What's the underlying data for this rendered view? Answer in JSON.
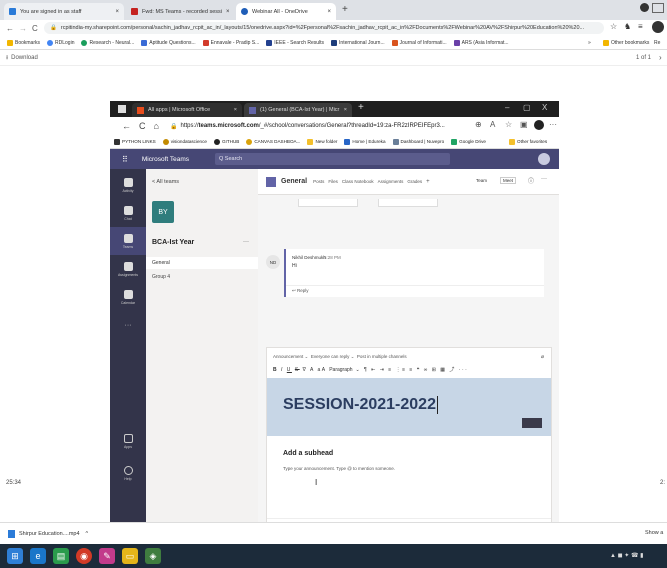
{
  "browser": {
    "tabs": [
      {
        "label": "You are signed in as staff",
        "fav_color": "#2b7bd8"
      },
      {
        "label": "Fwd: MS Teams - recorded sessi",
        "fav_color": "#c5221f"
      },
      {
        "label": "Webinar All - OneDrive",
        "fav_color": "#1f5eb8"
      }
    ],
    "address": "rcpitindia-my.sharepoint.com/personal/sachin_jadhav_rcpit_ac_in/_layouts/15/onedrive.aspx?id=%2Fpersonal%2Fsachin_jadhav_rcpit_ac_in%2FDocuments%2FWebinar%20AV%2FShirpur%20Education%20%20...",
    "bookmarks": [
      "Bookmarks",
      "RDLogin",
      "Research - Neural...",
      "Aptitude Questions...",
      "Ennavale - Pradip S...",
      "IEEE - Search Results",
      "International Journ...",
      "Journal of Informati...",
      "ARS (Asia Informat..."
    ],
    "other_bookmarks": "Other bookmarks",
    "bookmarks_overflow": "»",
    "read_label": "Re"
  },
  "viewer": {
    "download_label": "Download",
    "page_counter": "1 of 1",
    "next_label": "›",
    "time_left": "25:34",
    "time_right": "2:"
  },
  "inner": {
    "tabs": [
      {
        "label": "All apps | Microsoft Office"
      },
      {
        "label": "(1) General (BCA-Ist Year) | Micr"
      }
    ],
    "address_prefix": "https://",
    "address_host": "teams.microsoft.com",
    "address_path": "/_#/school/conversations/General?threadId=19:za-FR2zIRPEIFEpr3...",
    "bookmarks": [
      "PYTHON LINKS",
      "visiondatascience",
      "GITHUB",
      "CANVAS DASHBOA...",
      "New folder",
      "Home | Edureka",
      "Dashboard | Nuvepro",
      "Google Drive"
    ],
    "other_bookmarks": "Other favorites",
    "window_controls": [
      "–",
      "▢",
      "X"
    ]
  },
  "teams": {
    "app_name": "Microsoft Teams",
    "search_placeholder": "Q Search",
    "rail": [
      "Activity",
      "Chat",
      "Teams",
      "Assignments",
      "Calendar",
      "···"
    ],
    "rail_bottom": [
      "Apps",
      "Help"
    ],
    "back_label": "< All teams",
    "avatar": "BY",
    "team_name": "BCA-Ist Year",
    "team_more": "···",
    "channels": [
      "General",
      "Group 4"
    ],
    "channel_name": "General",
    "channel_tabs": [
      "Posts",
      "Files",
      "Class Notebook",
      "Assignments",
      "Grades",
      "+"
    ],
    "header_right": [
      "Team",
      "Meet",
      "ⓘ",
      "···"
    ],
    "message": {
      "initials": "ND",
      "author": "Nikhil Deshmukh",
      "time": "5:28 PM",
      "text": "Hi",
      "reply": "↩ Reply"
    },
    "compose": {
      "announcement_chip": "Announcement",
      "reply_chip": "Everyone can reply",
      "post_in_chip": "Post in multiple channels",
      "paragraph_label": "Paragraph",
      "format_tools": [
        "B",
        "I",
        "U",
        "S",
        "∇",
        "A",
        "aA"
      ],
      "headline": "SESSION-2021-2022",
      "subhead": "Add a subhead",
      "body_placeholder": "Type your announcement. Type @ to mention someone.",
      "cursor": "I"
    }
  },
  "bottom": {
    "download_file": "Shirpur Education....mp4",
    "download_chevron": "^",
    "show_all": "Show a"
  },
  "colors": {
    "teams_purple": "#464775",
    "rail_dark": "#33344a",
    "headline_bg": "#c7d6e6",
    "headline_text": "#2b3d60"
  }
}
